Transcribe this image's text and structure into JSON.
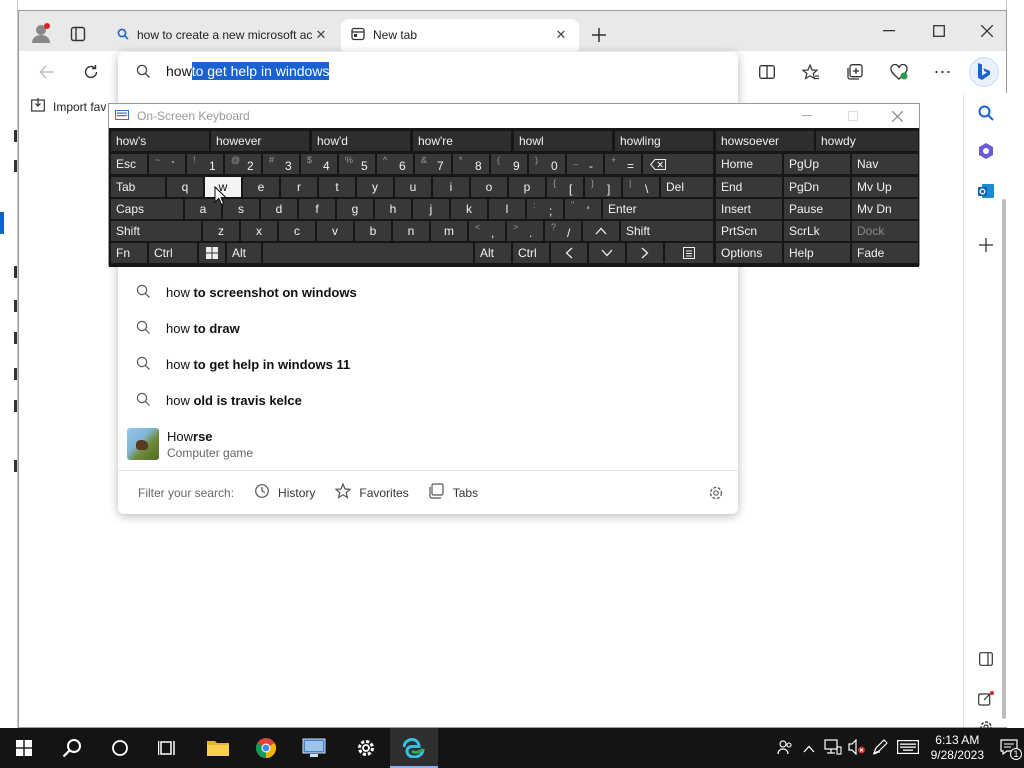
{
  "browser": {
    "tabs": [
      {
        "title": "how to create a new microsoft ac",
        "icon": "search-icon",
        "active": false
      },
      {
        "title": "New tab",
        "icon": "newtab-icon",
        "active": true
      }
    ]
  },
  "favorites_bar": {
    "import_label": "Import fav"
  },
  "omnibox": {
    "typed": "how",
    "autocomplete": " to get help in windows",
    "suggestions": [
      {
        "plain": "how ",
        "bold": "to screenshot on windows"
      },
      {
        "plain": "how ",
        "bold": "to draw"
      },
      {
        "plain": "how ",
        "bold": "to get help in windows 11"
      },
      {
        "plain": "how ",
        "bold": "old is travis kelce"
      }
    ],
    "entity": {
      "title_plain": "How",
      "title_bold": "rse",
      "subtitle": "Computer game"
    },
    "filter": {
      "label": "Filter your search:",
      "history": "History",
      "favorites": "Favorites",
      "tabs": "Tabs"
    }
  },
  "osk": {
    "title": "On-Screen Keyboard",
    "predictions": [
      "how's",
      "however",
      "how'd",
      "how're",
      "howl",
      "howling",
      "howsoever",
      "howdy"
    ],
    "row1": {
      "esc": "Esc",
      "keys": [
        {
          "top": "~",
          "bot": "`"
        },
        {
          "top": "!",
          "bot": "1"
        },
        {
          "top": "@",
          "bot": "2"
        },
        {
          "top": "#",
          "bot": "3"
        },
        {
          "top": "$",
          "bot": "4"
        },
        {
          "top": "%",
          "bot": "5"
        },
        {
          "top": "^",
          "bot": "6"
        },
        {
          "top": "&",
          "bot": "7"
        },
        {
          "top": "*",
          "bot": "8"
        },
        {
          "top": "(",
          "bot": "9"
        },
        {
          "top": ")",
          "bot": "0"
        },
        {
          "top": "_",
          "bot": "-"
        },
        {
          "top": "+",
          "bot": "="
        }
      ]
    },
    "row2": {
      "tab": "Tab",
      "letters": [
        "q",
        "w",
        "e",
        "r",
        "t",
        "y",
        "u",
        "i",
        "o",
        "p"
      ],
      "brackets": [
        {
          "top": "{",
          "bot": "["
        },
        {
          "top": "}",
          "bot": "]"
        },
        {
          "top": "|",
          "bot": "\\"
        }
      ],
      "del": "Del"
    },
    "row3": {
      "caps": "Caps",
      "letters": [
        "a",
        "s",
        "d",
        "f",
        "g",
        "h",
        "j",
        "k",
        "l"
      ],
      "punct": [
        {
          "top": ":",
          "bot": ";"
        },
        {
          "top": "\"",
          "bot": "'"
        }
      ],
      "enter": "Enter"
    },
    "row4": {
      "shift": "Shift",
      "letters": [
        "z",
        "x",
        "c",
        "v",
        "b",
        "n",
        "m"
      ],
      "punct": [
        {
          "top": "<",
          "bot": ","
        },
        {
          "top": ">",
          "bot": "."
        },
        {
          "top": "?",
          "bot": "/"
        }
      ],
      "shift_r": "Shift"
    },
    "row5": {
      "fn": "Fn",
      "ctrl": "Ctrl",
      "alt": "Alt",
      "alt_r": "Alt",
      "ctrl_r": "Ctrl"
    },
    "nav": [
      [
        "Home",
        "PgUp",
        "Nav"
      ],
      [
        "End",
        "PgDn",
        "Mv Up"
      ],
      [
        "Insert",
        "Pause",
        "Mv Dn"
      ],
      [
        "PrtScn",
        "ScrLk",
        "Dock"
      ],
      [
        "Options",
        "Help",
        "Fade"
      ]
    ],
    "highlighted_key": "w"
  },
  "taskbar": {
    "time": "6:13 AM",
    "date": "9/28/2023",
    "notification_count": "1"
  },
  "colors": {
    "accent": "#1a61d1",
    "osk_bg": "#161616",
    "osk_key": "#383838",
    "taskbar": "#141414"
  }
}
